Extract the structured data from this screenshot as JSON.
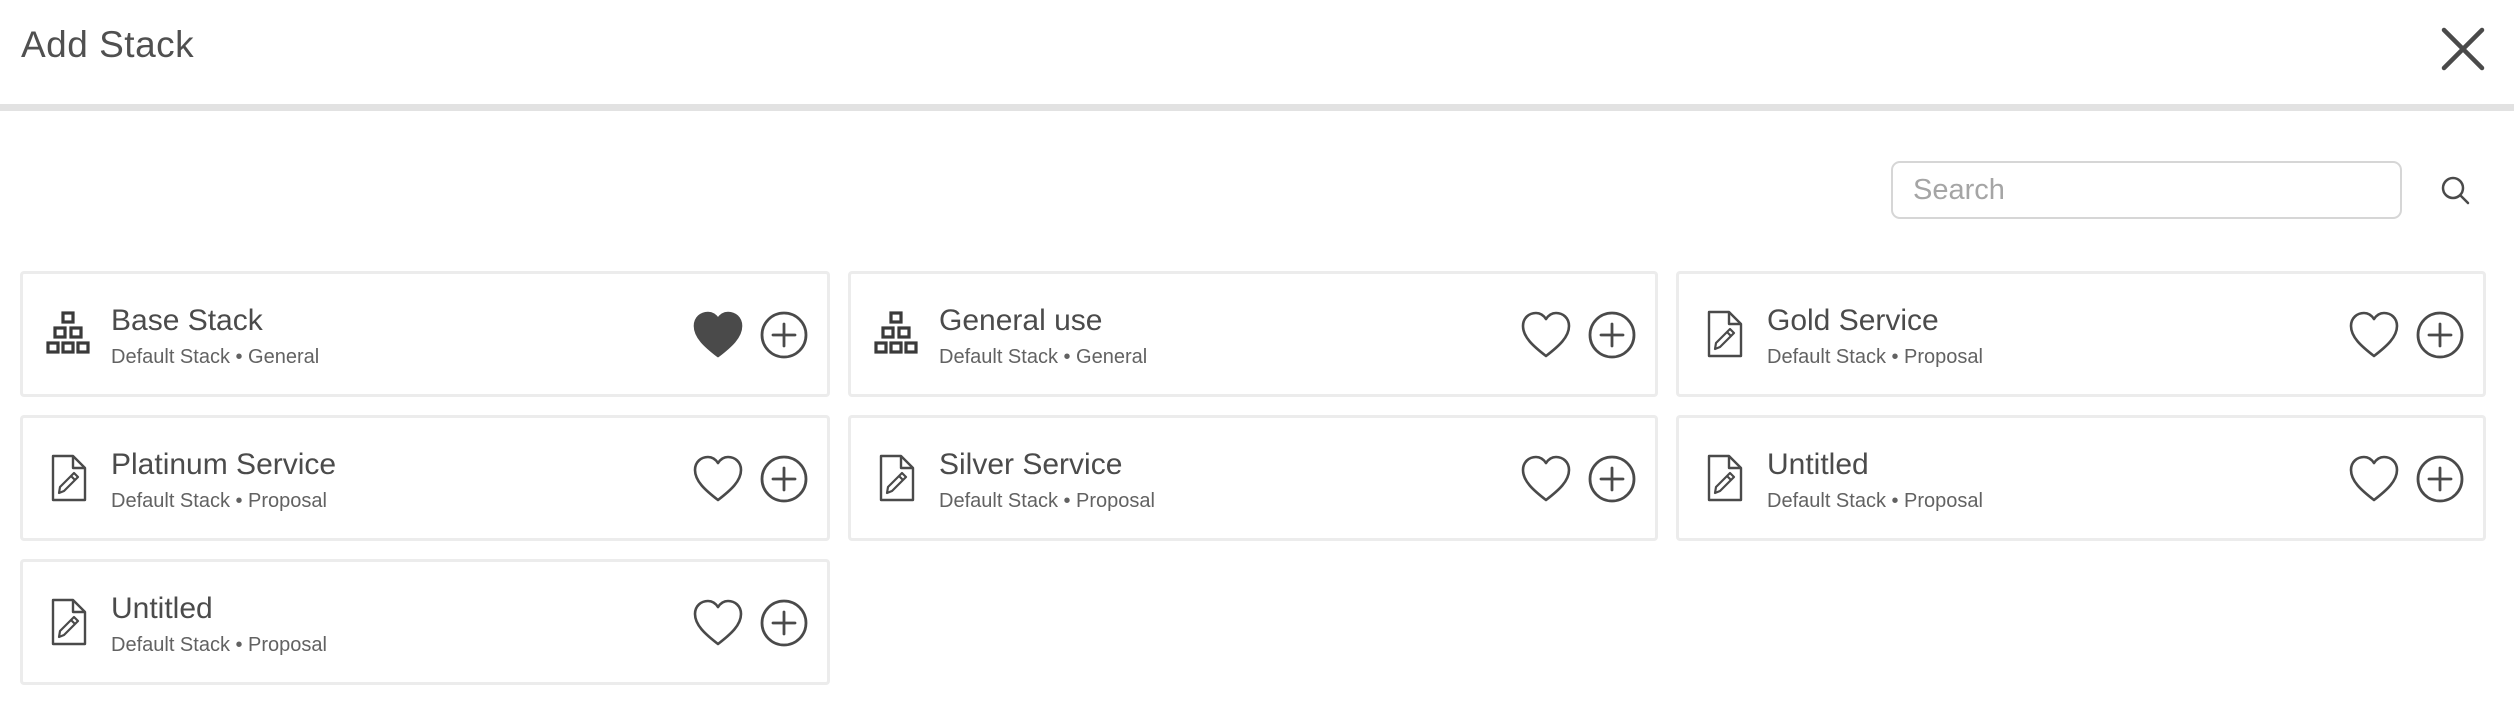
{
  "dialog": {
    "title": "Add Stack",
    "close_icon": "close-icon"
  },
  "search": {
    "placeholder": "Search",
    "value": "",
    "icon": "search-icon"
  },
  "stacks": [
    {
      "title": "Base Stack",
      "subtitle": "Default Stack • General",
      "icon": "blocks-icon",
      "favorited": true
    },
    {
      "title": "General use",
      "subtitle": "Default Stack • General",
      "icon": "blocks-icon",
      "favorited": false
    },
    {
      "title": "Gold Service",
      "subtitle": "Default Stack • Proposal",
      "icon": "document-edit-icon",
      "favorited": false
    },
    {
      "title": "Platinum Service",
      "subtitle": "Default Stack • Proposal",
      "icon": "document-edit-icon",
      "favorited": false
    },
    {
      "title": "Silver Service",
      "subtitle": "Default Stack • Proposal",
      "icon": "document-edit-icon",
      "favorited": false
    },
    {
      "title": "Untitled",
      "subtitle": "Default Stack • Proposal",
      "icon": "document-edit-icon",
      "favorited": false
    },
    {
      "title": "Untitled",
      "subtitle": "Default Stack • Proposal",
      "icon": "document-edit-icon",
      "favorited": false
    }
  ],
  "colors": {
    "icon": "#4a4a4a",
    "heart_filled": "#4a4a4a",
    "divider": "#e2e2e2",
    "card_border": "#ececec"
  }
}
